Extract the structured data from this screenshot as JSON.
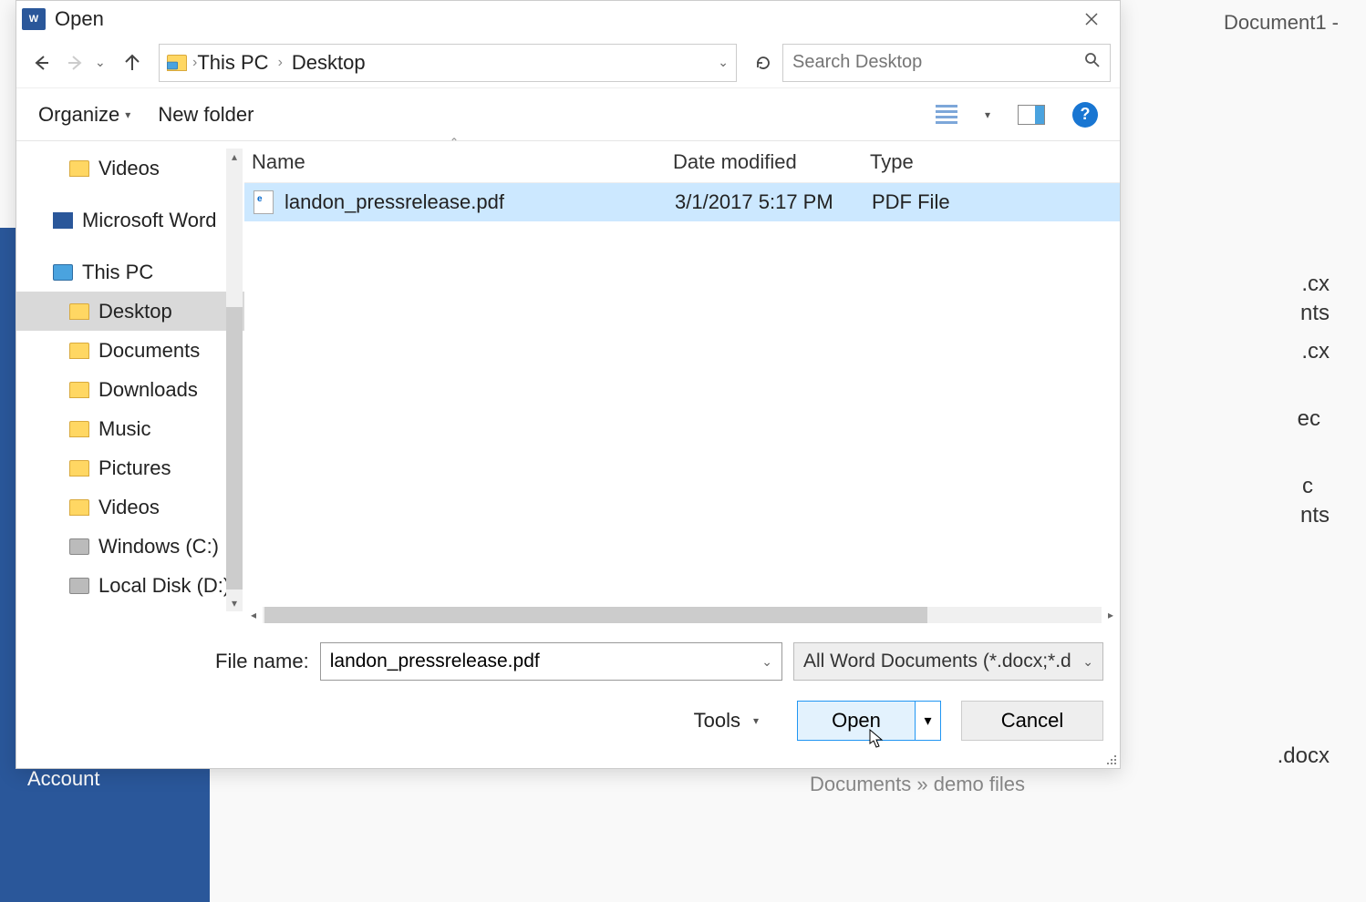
{
  "backdrop": {
    "doc_title": "Document1 -",
    "account": "Account",
    "items": [
      {
        "label": ".cx"
      },
      {
        "label": "nts"
      },
      {
        "label": ".cx"
      },
      {
        "label": "ec"
      },
      {
        "label": "c"
      },
      {
        "label": "nts"
      },
      {
        "label": ".docx"
      }
    ],
    "recent_path": "Documents » demo files"
  },
  "dialog": {
    "title": "Open",
    "breadcrumb": [
      "This PC",
      "Desktop"
    ],
    "search_placeholder": "Search Desktop",
    "toolbar": {
      "organize": "Organize",
      "new_folder": "New folder"
    },
    "tree": [
      {
        "icon": "folder",
        "label": "Videos",
        "indent": 1
      },
      {
        "icon": "word",
        "label": "Microsoft Word",
        "indent": 0
      },
      {
        "icon": "pc",
        "label": "This PC",
        "indent": 0
      },
      {
        "icon": "folder",
        "label": "Desktop",
        "indent": 1,
        "selected": true
      },
      {
        "icon": "folder",
        "label": "Documents",
        "indent": 1
      },
      {
        "icon": "folder",
        "label": "Downloads",
        "indent": 1
      },
      {
        "icon": "folder",
        "label": "Music",
        "indent": 1
      },
      {
        "icon": "folder",
        "label": "Pictures",
        "indent": 1
      },
      {
        "icon": "folder",
        "label": "Videos",
        "indent": 1
      },
      {
        "icon": "drive",
        "label": "Windows (C:)",
        "indent": 1
      },
      {
        "icon": "drive",
        "label": "Local Disk (D:)",
        "indent": 1
      }
    ],
    "columns": {
      "name": "Name",
      "date": "Date modified",
      "type": "Type"
    },
    "files": [
      {
        "name": "landon_pressrelease.pdf",
        "date": "3/1/2017 5:17 PM",
        "type": "PDF File",
        "selected": true
      }
    ],
    "footer": {
      "filename_label": "File name:",
      "filename_value": "landon_pressrelease.pdf",
      "filter": "All Word Documents (*.docx;*.d",
      "tools": "Tools",
      "open": "Open",
      "cancel": "Cancel"
    }
  }
}
